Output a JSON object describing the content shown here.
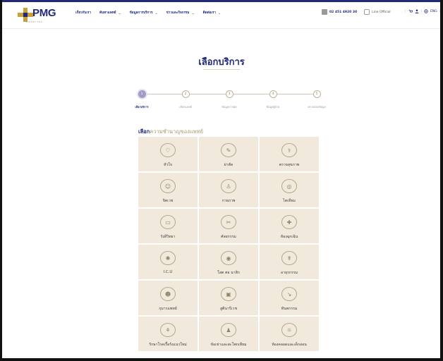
{
  "header": {
    "logo_text": "PMG",
    "logo_sub": "HOSPITAL",
    "nav": [
      {
        "label": "เกี่ยวกับเรา",
        "dropdown": false
      },
      {
        "label": "ค้นหาแพทย์",
        "dropdown": true
      },
      {
        "label": "ข้อมูลการบริการ",
        "dropdown": true
      },
      {
        "label": "ข่าวและกิจกรรม",
        "dropdown": true
      },
      {
        "label": "ติดต่อเรา",
        "dropdown": true
      }
    ],
    "phone": "02 451 4920 30",
    "line": "Line Official",
    "language": "ENG"
  },
  "page": {
    "title": "เลือกบริการ"
  },
  "stepper": {
    "steps": [
      {
        "num": "1",
        "label": "เลือกบริการ",
        "active": true
      },
      {
        "num": "2",
        "label": "เลือกแพทย์",
        "active": false
      },
      {
        "num": "3",
        "label": "ข้อมูลการนัด",
        "active": false
      },
      {
        "num": "4",
        "label": "ข้อมูลผู้ป่วย",
        "active": false
      },
      {
        "num": "5",
        "label": "ตรวจสอบข้อมูล",
        "active": false
      }
    ]
  },
  "section": {
    "heading_bold": "เลือก",
    "heading_rest": "ความชำนาญของแพทย์"
  },
  "services": [
    {
      "label": "หัวใจ",
      "icon": "heart-icon"
    },
    {
      "label": "ผ่าตัด",
      "icon": "scalpel-icon"
    },
    {
      "label": "ตรวจสุขภาพ",
      "icon": "stethoscope-icon"
    },
    {
      "label": "จิตเวช",
      "icon": "brain-icon"
    },
    {
      "label": "กายภาพ",
      "icon": "foot-icon"
    },
    {
      "label": "ไตเทียม",
      "icon": "kidney-icon"
    },
    {
      "label": "รังสีวิทยา",
      "icon": "xray-icon"
    },
    {
      "label": "ศัลยกรรม",
      "icon": "surgery-icon"
    },
    {
      "label": "ห้องฉุกเฉิน",
      "icon": "ambulance-icon"
    },
    {
      "label": "I.C.U",
      "icon": "virus-icon"
    },
    {
      "label": "โสต ศอ นาสิก",
      "icon": "ent-icon"
    },
    {
      "label": "อายุรกรรม",
      "icon": "internal-medicine-icon"
    },
    {
      "label": "กุมารแพทย์",
      "icon": "baby-icon"
    },
    {
      "label": "สูตินารีเวช",
      "icon": "pregnancy-icon"
    },
    {
      "label": "ทันตกรรม",
      "icon": "dental-icon"
    },
    {
      "label": "รักษาโรคเรื้อรังแนวใหม่",
      "icon": "chronic-care-icon"
    },
    {
      "label": "ข้อเข่าและสะโพกเทียม",
      "icon": "knee-icon"
    },
    {
      "label": "ห้องคลอดและเด็กอ่อน",
      "icon": "newborn-icon"
    }
  ]
}
